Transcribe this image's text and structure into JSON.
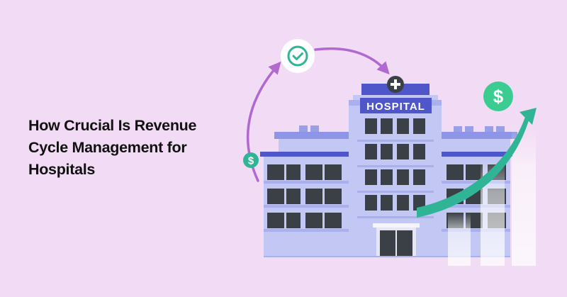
{
  "headline": {
    "lines": [
      "How Crucial Is Revenue",
      "Cycle Management for",
      "Hospitals"
    ]
  },
  "illustration": {
    "sign_text": "HOSPITAL",
    "icons": [
      "check-icon",
      "dollar-icon",
      "plus-icon",
      "growth-arrow-icon"
    ],
    "colors": {
      "background": "#f2dbf4",
      "building_light": "#c3c7f3",
      "building_mid": "#8f95e6",
      "building_accent": "#4f56c9",
      "window": "#3a4046",
      "cycle_arrow": "#b169cf",
      "growth_arrow": "#2fb595",
      "check_ring": "#2fb595"
    }
  }
}
